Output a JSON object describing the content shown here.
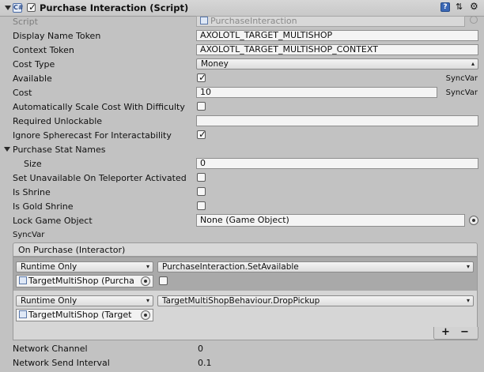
{
  "component": {
    "title": "Purchase Interaction (Script)"
  },
  "fields": {
    "script": {
      "label": "Script",
      "value": "PurchaseInteraction"
    },
    "display_name_token": {
      "label": "Display Name Token",
      "value": "AXOLOTL_TARGET_MULTISHOP"
    },
    "context_token": {
      "label": "Context Token",
      "value": "AXOLOTL_TARGET_MULTISHOP_CONTEXT"
    },
    "cost_type": {
      "label": "Cost Type",
      "value": "Money"
    },
    "available": {
      "label": "Available",
      "checked": true,
      "syncvar": "SyncVar"
    },
    "cost": {
      "label": "Cost",
      "value": "10",
      "syncvar": "SyncVar"
    },
    "auto_scale_cost": {
      "label": "Automatically Scale Cost With Difficulty",
      "checked": false
    },
    "required_unlockable": {
      "label": "Required Unlockable",
      "value": ""
    },
    "ignore_spherecast": {
      "label": "Ignore Spherecast For Interactability",
      "checked": true
    },
    "purchase_stat_names": {
      "label": "Purchase Stat Names",
      "size_label": "Size",
      "size_value": "0"
    },
    "set_unavailable_on_teleporter": {
      "label": "Set Unavailable On Teleporter Activated",
      "checked": false
    },
    "is_shrine": {
      "label": "Is Shrine",
      "checked": false
    },
    "is_gold_shrine": {
      "label": "Is Gold Shrine",
      "checked": false
    },
    "lock_game_object": {
      "label": "Lock Game Object",
      "value": "None (Game Object)",
      "syncvar": "SyncVar"
    }
  },
  "on_purchase": {
    "header": "On Purchase (Interactor)",
    "entries": [
      {
        "mode": "Runtime Only",
        "function": "PurchaseInteraction.SetAvailable",
        "target": "TargetMultiShop (Purcha",
        "has_checkbox": true
      },
      {
        "mode": "Runtime Only",
        "function": "TargetMultiShopBehaviour.DropPickup",
        "target": "TargetMultiShop (Target",
        "has_checkbox": false
      }
    ],
    "add_label": "+",
    "remove_label": "−"
  },
  "network": {
    "channel_label": "Network Channel",
    "channel_value": "0",
    "interval_label": "Network Send Interval",
    "interval_value": "0.1"
  }
}
